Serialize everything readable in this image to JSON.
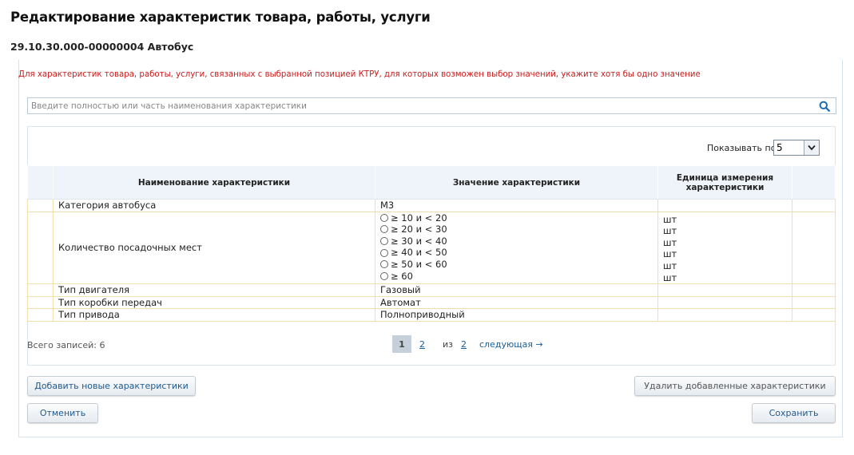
{
  "header": {
    "title": "Редактирование характеристик товара, работы, услуги",
    "subtitle": "29.10.30.000-00000004 Автобус"
  },
  "notice": "Для характеристик товара, работы, услуги, связанных с выбранной позицией КТРУ, для которых возможен выбор значений, укажите хотя бы одно значение",
  "search": {
    "placeholder": "Введите полностью или часть наименования характеристики",
    "value": "",
    "icon": "search-icon"
  },
  "grid": {
    "show_label": "Показывать по",
    "page_size": "5",
    "columns": [
      "Наименование характеристики",
      "Значение характеристики",
      "Единица измерения характеристики"
    ],
    "rows": [
      {
        "name": "Категория автобуса",
        "value": "M3",
        "unit": ""
      },
      {
        "name": "Количество посадочных мест",
        "options": [
          {
            "label": "≥ 10 и < 20",
            "unit": "шт"
          },
          {
            "label": "≥ 20 и < 30",
            "unit": "шт"
          },
          {
            "label": "≥ 30 и < 40",
            "unit": "шт"
          },
          {
            "label": "≥ 40 и < 50",
            "unit": "шт"
          },
          {
            "label": "≥ 50 и < 60",
            "unit": "шт"
          },
          {
            "label": "≥ 60",
            "unit": "шт"
          }
        ]
      },
      {
        "name": "Тип двигателя",
        "value": "Газовый",
        "unit": ""
      },
      {
        "name": "Тип коробки передач",
        "value": "Автомат",
        "unit": ""
      },
      {
        "name": "Тип привода",
        "value": "Полноприводный",
        "unit": ""
      }
    ],
    "total": "Всего записей: 6",
    "pager": {
      "current": "1",
      "page2": "2",
      "of": "из",
      "total_pages": "2",
      "next": "следующая →"
    }
  },
  "buttons": {
    "add": "Добавить новые характеристики",
    "delete": "Удалить добавленные характеристики",
    "cancel": "Отменить",
    "save": "Сохранить"
  },
  "colors": {
    "notice": "#cc1a1a",
    "link": "#1a5fa0",
    "header_bg": "#eef4f9",
    "row_border": "#f0e0b0"
  }
}
